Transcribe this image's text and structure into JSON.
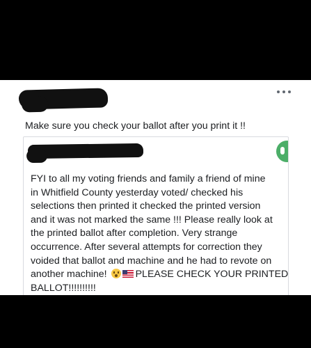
{
  "post": {
    "menu_icon": "more-horizontal-icon",
    "caption": "Make sure you check your ballot after you print it !!"
  },
  "shared_post": {
    "badge_icon": "green-profile-icon",
    "lines": [
      "FYI to all my voting friends and family a friend of mine",
      "in Whitfield County yesterday voted/ checked his",
      "selections then printed it checked the printed version",
      "and it was not marked the same !!! Please really look at",
      "the printed ballot after completion.  Very strange",
      "occurrence. After several attempts for correction they",
      "voided that ballot and machine and he had to revote on"
    ],
    "line8_start": "another machine!",
    "line8_end": "PLEASE CHECK YOUR PRINTED",
    "line9": "BALLOT!!!!!!!!!!",
    "emoji_1": "grimacing-face-emoji",
    "emoji_2": "us-flag-emoji"
  },
  "colors": {
    "background": "#000000",
    "card": "#ffffff",
    "text": "#1c1e21",
    "border": "#d8dadf",
    "badge": "#4cae68"
  }
}
